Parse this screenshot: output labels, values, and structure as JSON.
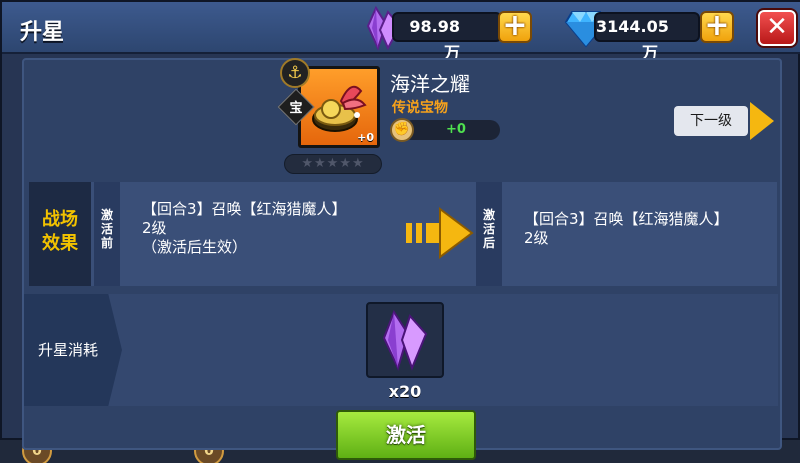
{
  "window": {
    "title": "升星",
    "close_label": "✕"
  },
  "resources": {
    "crystal": {
      "icon": "purple-crystal-icon",
      "value": "98.98万",
      "plus_label": "+"
    },
    "diamond": {
      "icon": "blue-diamond-icon",
      "value": "3144.05万",
      "plus_label": "+"
    }
  },
  "item": {
    "name": "海洋之耀",
    "rarity": "传说宝物",
    "badge_type": "宝",
    "anchor_icon": "⚓",
    "level_plus": "+0",
    "power_bonus": "+0",
    "stars": "★★★★★",
    "filled_stars": 0,
    "total_stars": 5
  },
  "next_level": {
    "label": "下一级"
  },
  "battle_effect": {
    "label_line1": "战场",
    "label_line2": "效果",
    "before_tab": [
      "激",
      "活",
      "前"
    ],
    "after_tab": [
      "激",
      "活",
      "后"
    ],
    "before_text_line1": "【回合3】召唤【红海猎魔人】",
    "before_text_line2": "2级",
    "before_text_line3": "（激活后生效）",
    "after_text_line1": "【回合3】召唤【红海猎魔人】",
    "after_text_line2": "2级"
  },
  "cost": {
    "label": "升星消耗",
    "icon": "purple-crystal-icon",
    "quantity": "x20"
  },
  "actions": {
    "activate_label": "激活"
  },
  "background_slots": {
    "slot1_value": "0",
    "slot2_value": "0"
  },
  "colors": {
    "legendary": "#f7a21b",
    "accent_gold": "#f2c200",
    "activate_green": "#7ccf2a",
    "power_green": "#4fe04f"
  }
}
